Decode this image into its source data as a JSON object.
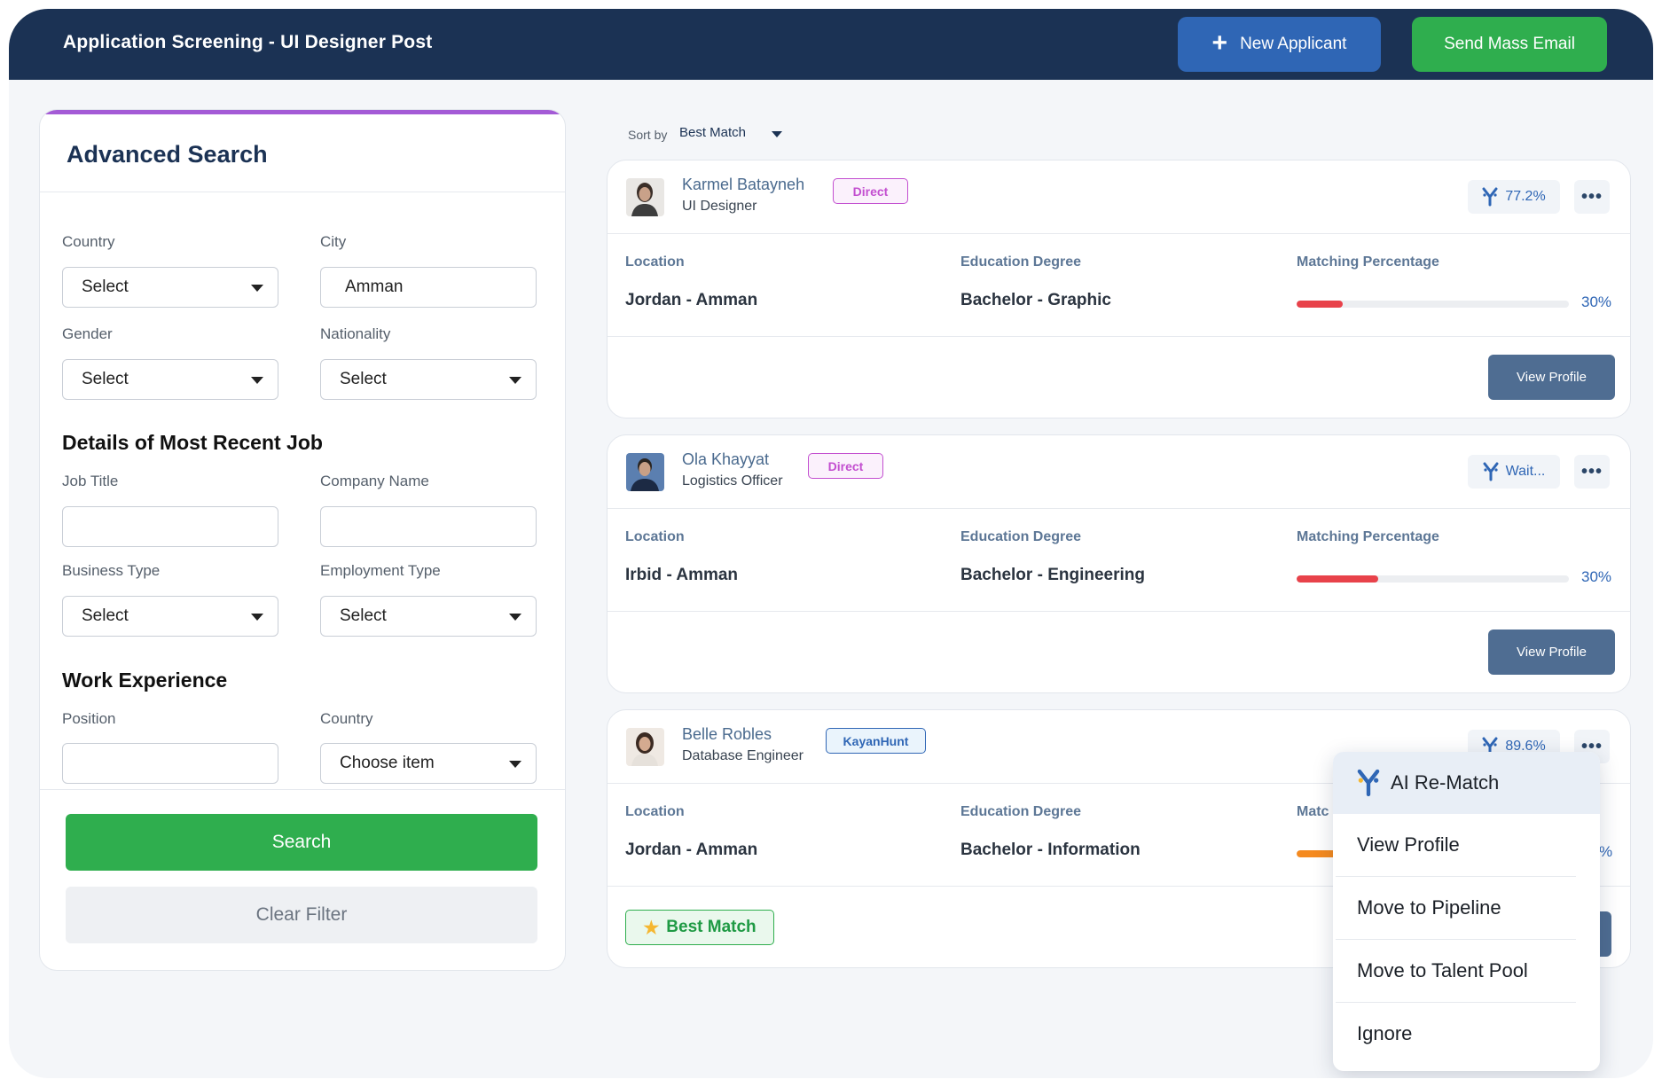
{
  "header": {
    "title": "Application Screening - UI Designer Post",
    "new_applicant_label": "New Applicant",
    "send_mass_email_label": "Send Mass Email"
  },
  "search": {
    "title": "Advanced Search",
    "country_label": "Country",
    "country_value": "Select",
    "city_label": "City",
    "city_value": "Amman",
    "gender_label": "Gender",
    "gender_value": "Select",
    "nationality_label": "Nationality",
    "nationality_value": "Select",
    "recent_job_title": "Details of Most Recent Job",
    "job_title_label": "Job Title",
    "job_title_value": "",
    "company_name_label": "Company Name",
    "company_name_value": "",
    "business_type_label": "Business Type",
    "business_type_value": "Select",
    "employment_type_label": "Employment Type",
    "employment_type_value": "Select",
    "work_experience_title": "Work Experience",
    "position_label": "Position",
    "position_value": "",
    "we_country_label": "Country",
    "we_country_value": "Choose item",
    "search_button": "Search",
    "clear_button": "Clear Filter"
  },
  "sort": {
    "label": "Sort by",
    "value": "Best Match"
  },
  "candidates": [
    {
      "name": "Karmel Batayneh",
      "role": "UI Designer",
      "tag": "Direct",
      "match": "77.2%",
      "location_label": "Location",
      "location": "Jordan - Amman",
      "education_label": "Education Degree",
      "education": "Bachelor - Graphic",
      "matching_label": "Matching Percentage",
      "matching_pct": "30%",
      "bar_fraction": 0.17,
      "bar_color": "#e8424a",
      "view_label": "View Profile"
    },
    {
      "name": "Ola Khayyat",
      "role": "Logistics Officer",
      "tag": "Direct",
      "match": "Wait...",
      "location_label": "Location",
      "location": "Irbid - Amman",
      "education_label": "Education Degree",
      "education": "Bachelor - Engineering",
      "matching_label": "Matching Percentage",
      "matching_pct": "30%",
      "bar_fraction": 0.3,
      "bar_color": "#e8424a",
      "view_label": "View Profile"
    },
    {
      "name": "Belle Robles",
      "role": "Database Engineer",
      "tag": "KayanHunt",
      "match": "89.6%",
      "location_label": "Location",
      "location": "Jordan - Amman",
      "education_label": "Education Degree",
      "education": "Bachelor - Information",
      "matching_label": "Matc",
      "matching_pct": "%",
      "bar_color": "#f58a1f",
      "best_match_label": "Best Match"
    }
  ],
  "menu": {
    "items": [
      "AI Re-Match",
      "View Profile",
      "Move to Pipeline",
      "Move to Talent Pool",
      "Ignore"
    ]
  },
  "colors": {
    "header_bg": "#1b3254",
    "primary_blue": "#2f66b5",
    "green": "#2fae4e",
    "view_button": "#4f6d92"
  }
}
